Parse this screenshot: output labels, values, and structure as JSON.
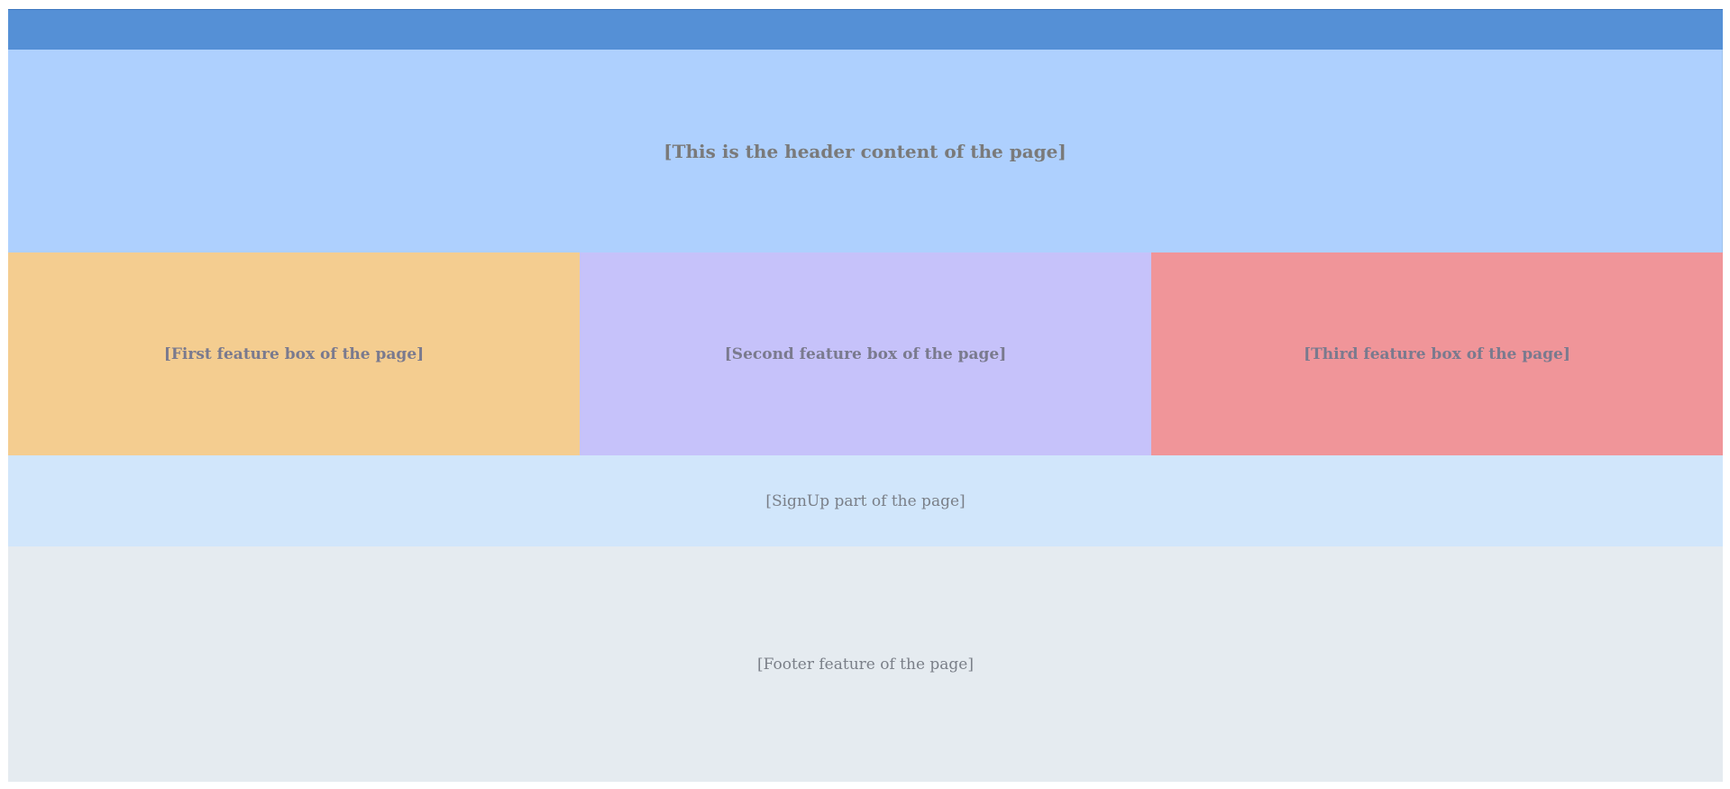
{
  "colors": {
    "topbar": "#5590d6",
    "header": "#aed0fe",
    "feature_1": "#f4cd90",
    "feature_2": "#c6c2fa",
    "feature_3": "#f09599",
    "signup": "#d1e6fb",
    "footer": "#e5ebf0"
  },
  "header": {
    "text": "[This is the header content of the page]"
  },
  "features": [
    {
      "text": "[First feature box of the page]"
    },
    {
      "text": "[Second feature box of the page]"
    },
    {
      "text": "[Third feature box of the page]"
    }
  ],
  "signup": {
    "text": "[SignUp part of the page]"
  },
  "footer": {
    "text": "[Footer feature of the page]"
  }
}
